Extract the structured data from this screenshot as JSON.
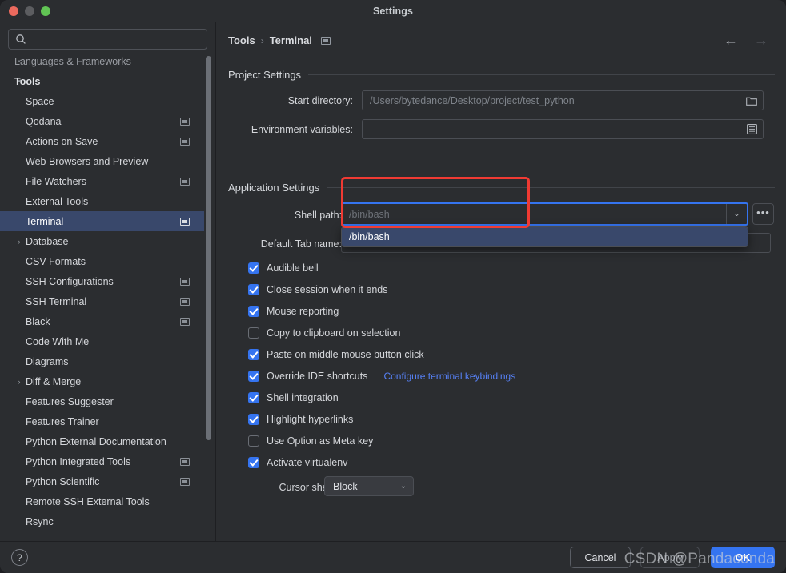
{
  "window": {
    "title": "Settings",
    "traffic_lights": [
      "close",
      "minimize",
      "maximize"
    ]
  },
  "sidebar": {
    "search": {
      "value": "",
      "placeholder": ""
    },
    "items": [
      {
        "label": "Languages & Frameworks",
        "level": 0,
        "arrow": "down",
        "chip": false,
        "selected": false,
        "clipped": true
      },
      {
        "label": "Tools",
        "level": 0,
        "arrow": "down",
        "chip": false,
        "selected": false,
        "bold": true
      },
      {
        "label": "Space",
        "level": 1,
        "arrow": "",
        "chip": false,
        "selected": false
      },
      {
        "label": "Qodana",
        "level": 1,
        "arrow": "",
        "chip": true,
        "selected": false
      },
      {
        "label": "Actions on Save",
        "level": 1,
        "arrow": "",
        "chip": true,
        "selected": false
      },
      {
        "label": "Web Browsers and Preview",
        "level": 1,
        "arrow": "",
        "chip": false,
        "selected": false
      },
      {
        "label": "File Watchers",
        "level": 1,
        "arrow": "",
        "chip": true,
        "selected": false
      },
      {
        "label": "External Tools",
        "level": 1,
        "arrow": "",
        "chip": false,
        "selected": false
      },
      {
        "label": "Terminal",
        "level": 1,
        "arrow": "",
        "chip": true,
        "selected": true
      },
      {
        "label": "Database",
        "level": 1,
        "arrow": "right",
        "chip": false,
        "selected": false
      },
      {
        "label": "CSV Formats",
        "level": 1,
        "arrow": "",
        "chip": false,
        "selected": false
      },
      {
        "label": "SSH Configurations",
        "level": 1,
        "arrow": "",
        "chip": true,
        "selected": false
      },
      {
        "label": "SSH Terminal",
        "level": 1,
        "arrow": "",
        "chip": true,
        "selected": false
      },
      {
        "label": "Black",
        "level": 1,
        "arrow": "",
        "chip": true,
        "selected": false
      },
      {
        "label": "Code With Me",
        "level": 1,
        "arrow": "",
        "chip": false,
        "selected": false
      },
      {
        "label": "Diagrams",
        "level": 1,
        "arrow": "",
        "chip": false,
        "selected": false
      },
      {
        "label": "Diff & Merge",
        "level": 1,
        "arrow": "right",
        "chip": false,
        "selected": false
      },
      {
        "label": "Features Suggester",
        "level": 1,
        "arrow": "",
        "chip": false,
        "selected": false
      },
      {
        "label": "Features Trainer",
        "level": 1,
        "arrow": "",
        "chip": false,
        "selected": false
      },
      {
        "label": "Python External Documentation",
        "level": 1,
        "arrow": "",
        "chip": false,
        "selected": false
      },
      {
        "label": "Python Integrated Tools",
        "level": 1,
        "arrow": "",
        "chip": true,
        "selected": false
      },
      {
        "label": "Python Scientific",
        "level": 1,
        "arrow": "",
        "chip": true,
        "selected": false
      },
      {
        "label": "Remote SSH External Tools",
        "level": 1,
        "arrow": "",
        "chip": false,
        "selected": false
      },
      {
        "label": "Rsync",
        "level": 1,
        "arrow": "",
        "chip": false,
        "selected": false
      }
    ]
  },
  "breadcrumb": {
    "root": "Tools",
    "separator": "›",
    "current": "Terminal"
  },
  "nav": {
    "back": "←",
    "forward": "→"
  },
  "sections": {
    "project": {
      "title": "Project Settings",
      "start_directory": {
        "label": "Start directory:",
        "value": "/Users/bytedance/Desktop/project/test_python",
        "icon": "folder-icon"
      },
      "environment_variables": {
        "label": "Environment variables:",
        "value": "",
        "icon": "list-icon"
      }
    },
    "application": {
      "title": "Application Settings",
      "shell_path": {
        "label": "Shell path:",
        "value": "/bin/bash",
        "dropdown_arrow": "⌄",
        "browse_label": "•••",
        "options": [
          "/bin/bash"
        ],
        "highlighted_option": "/bin/bash"
      },
      "default_tab_name": {
        "label": "Default Tab name:",
        "value": ""
      },
      "checkboxes": [
        {
          "label": "Audible bell",
          "checked": true
        },
        {
          "label": "Close session when it ends",
          "checked": true
        },
        {
          "label": "Mouse reporting",
          "checked": true
        },
        {
          "label": "Copy to clipboard on selection",
          "checked": false
        },
        {
          "label": "Paste on middle mouse button click",
          "checked": true
        },
        {
          "label": "Override IDE shortcuts",
          "checked": true,
          "link": "Configure terminal keybindings"
        },
        {
          "label": "Shell integration",
          "checked": true
        },
        {
          "label": "Highlight hyperlinks",
          "checked": true
        },
        {
          "label": "Use Option as Meta key",
          "checked": false
        },
        {
          "label": "Activate virtualenv",
          "checked": true
        }
      ],
      "cursor_shape": {
        "label": "Cursor shape:",
        "value": "Block",
        "arrow": "⌄"
      }
    }
  },
  "footer": {
    "help": "?",
    "cancel": "Cancel",
    "apply": "Apply",
    "ok": "OK"
  },
  "watermark": "CSDN @Pandaconda",
  "colors": {
    "background": "#2b2d30",
    "accent": "#3574f0",
    "selection": "#39486b",
    "annotation": "#f03a33",
    "link": "#5680f5"
  }
}
